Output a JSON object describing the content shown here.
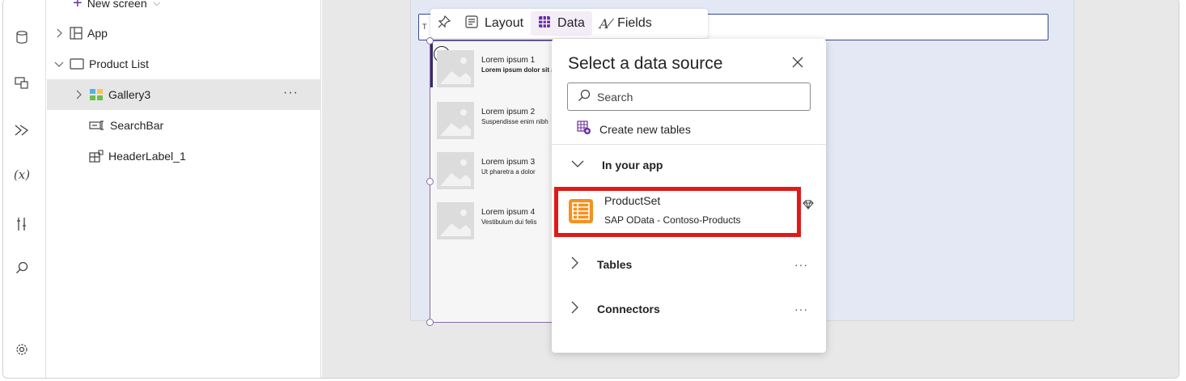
{
  "tree": {
    "new_screen_label": "New screen",
    "items": [
      {
        "label": "App"
      },
      {
        "label": "Product List"
      },
      {
        "label": "Gallery3"
      },
      {
        "label": "SearchBar"
      },
      {
        "label": "HeaderLabel_1"
      }
    ],
    "more_label": "···"
  },
  "rail": {
    "icons": [
      "database-icon",
      "screens-icon",
      "power-automate-icon",
      "variables-icon",
      "tools-icon",
      "search-icon",
      "settings-icon"
    ],
    "variables_label": "(x)"
  },
  "canvas": {
    "searchbar_text": "T",
    "gallery_items": [
      {
        "title": "Lorem ipsum 1",
        "subtitle": "Lorem ipsum dolor sit amet"
      },
      {
        "title": "Lorem ipsum 2",
        "subtitle": "Suspendisse enim nibh"
      },
      {
        "title": "Lorem ipsum 3",
        "subtitle": "Ut pharetra a dolor"
      },
      {
        "title": "Lorem ipsum 4",
        "subtitle": "Vestibulum dui felis"
      }
    ]
  },
  "toolbar": {
    "layout_label": "Layout",
    "data_label": "Data",
    "fields_label": "Fields"
  },
  "panel": {
    "title": "Select a data source",
    "search_placeholder": "Search",
    "create_label": "Create new tables",
    "section_in_app": "In your app",
    "source_name": "ProductSet",
    "source_sub": "SAP OData - Contoso-Products",
    "section_tables": "Tables",
    "section_connectors": "Connectors",
    "more_label": "···"
  },
  "colors": {
    "accent_purple": "#6b2fa0",
    "highlight_red": "#e01919",
    "source_orange": "#f7901e"
  }
}
